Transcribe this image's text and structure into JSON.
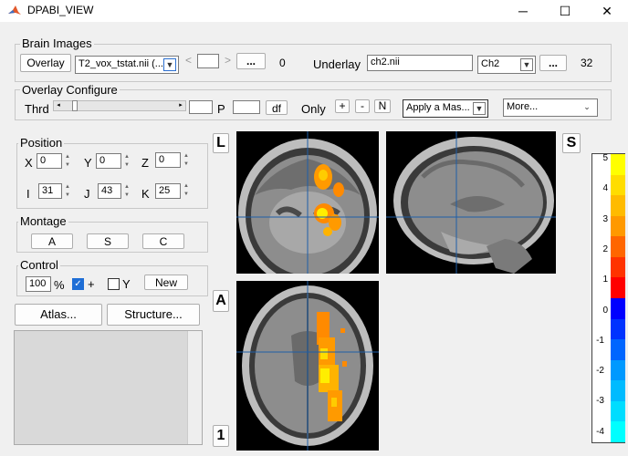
{
  "window": {
    "title": "DPABI_VIEW",
    "minimize": "─",
    "maximize": "☐",
    "close": "✕"
  },
  "brain_images": {
    "label": "Brain Images",
    "overlay_button": "Overlay",
    "overlay_value": "T2_vox_tstat.nii (...",
    "prev": "<",
    "next": ">",
    "browse": "...",
    "overlay_count": "0",
    "underlay_label": "Underlay",
    "underlay_value": "ch2.nii",
    "template_value": "Ch2",
    "underlay_browse": "...",
    "underlay_count": "32"
  },
  "overlay_configure": {
    "label": "Overlay Configure",
    "thrd_label": "Thrd",
    "p_label": "P",
    "df_button": "df",
    "only_label": "Only",
    "plus": "+",
    "minus": "-",
    "n": "N",
    "mask_value": "Apply a Mas...",
    "more_value": "More..."
  },
  "position": {
    "label": "Position",
    "x_label": "X",
    "x_value": "0",
    "y_label": "Y",
    "y_value": "0",
    "z_label": "Z",
    "z_value": "0",
    "i_label": "I",
    "i_value": "31",
    "j_label": "J",
    "j_value": "43",
    "k_label": "K",
    "k_value": "25"
  },
  "montage": {
    "label": "Montage",
    "a": "A",
    "s": "S",
    "c": "C"
  },
  "control": {
    "label": "Control",
    "zoom_value": "100",
    "percent": "%",
    "cross_label": "+",
    "y_label": "Y",
    "new_button": "New"
  },
  "atlas_button": "Atlas...",
  "structure_button": "Structure...",
  "view_labels": {
    "coronal": "L",
    "sagittal": "S",
    "axial": "A",
    "extra": "1"
  },
  "colorbar": {
    "labels": [
      "5",
      "4",
      "3",
      "2",
      "1",
      "0",
      "-1",
      "-2",
      "-3",
      "-4"
    ],
    "colors": [
      "#ffff00",
      "#ffdd00",
      "#ffbb00",
      "#ff9900",
      "#ff6600",
      "#ff3300",
      "#ff0000",
      "#0000ff",
      "#0033ff",
      "#0066ff",
      "#0099ff",
      "#00bbff",
      "#00ddff",
      "#00ffff"
    ]
  }
}
